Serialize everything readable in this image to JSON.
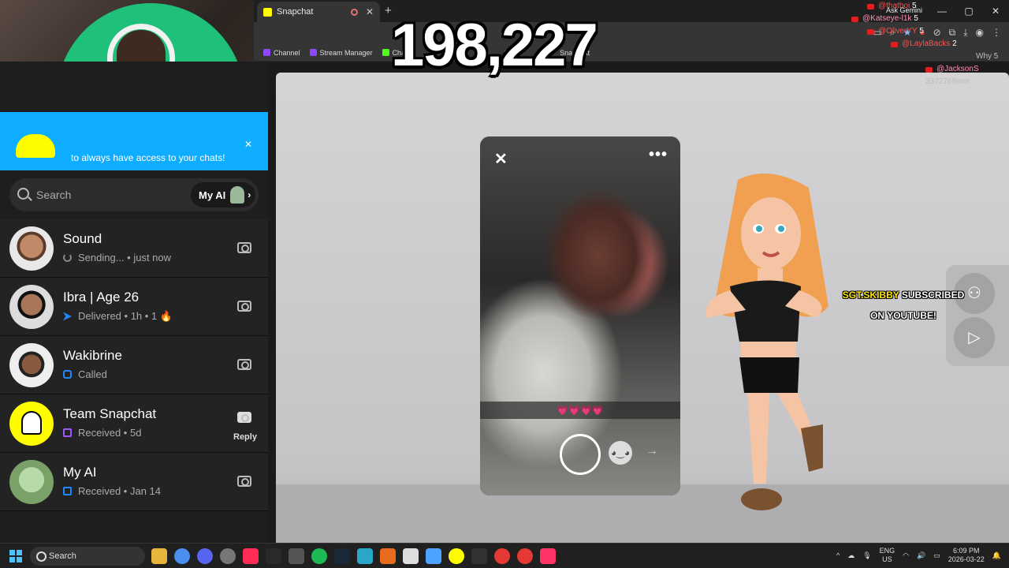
{
  "browser": {
    "tab_title": "Snapchat",
    "new_tab": "+",
    "bookmarks": [
      "Channel",
      "Stream Manager",
      "Chan",
      "(1)",
      "Snapchat"
    ],
    "ask_gemini": "Ask Gemini"
  },
  "stream_overlay": {
    "counter": "198,227",
    "sub_alert_user": "SGT.SKIBBY",
    "sub_alert_text": "SUBSCRIBED ON YOUTUBE!",
    "feed": [
      {
        "user": "@thatboi",
        "count": "5"
      },
      {
        "user": "@Katseye-l1k",
        "count": "5"
      },
      {
        "user": "@OliverYY",
        "count": "5"
      },
      {
        "user": "@LaylaBacks",
        "count": "2"
      },
      {
        "user": "Why 5",
        "count": ""
      },
      {
        "user": "@JacksonS",
        "count": ""
      },
      {
        "user": "3372769mm",
        "count": ""
      }
    ]
  },
  "sidebar": {
    "banner_line": "to always have access to your chats!",
    "search_placeholder": "Search",
    "my_ai_label": "My AI",
    "chats": [
      {
        "name": "Sound",
        "status": "Sending... • just now",
        "status_icon": "spinner-icon",
        "action": ""
      },
      {
        "name": "Ibra | Age 26",
        "status": "Delivered • 1h • 1 🔥",
        "status_icon": "delivered-arrow-icon",
        "action": ""
      },
      {
        "name": "Wakibrine",
        "status": "Called",
        "status_icon": "phone-call-icon",
        "action": ""
      },
      {
        "name": "Team Snapchat",
        "status": "Received • 5d",
        "status_icon": "received-snap-icon",
        "action": "Reply"
      },
      {
        "name": "My AI",
        "status": "Received • Jan 14",
        "status_icon": "received-chat-icon",
        "action": ""
      }
    ]
  },
  "snap_viewer": {
    "caption": "💗💗💗💗",
    "close_symbol": "✕",
    "more_symbol": "•••"
  },
  "taskbar": {
    "search_label": "Search",
    "lang_line1": "ENG",
    "lang_line2": "US",
    "time": "6:09 PM",
    "date": "2026-03-22"
  },
  "colors": {
    "snap_yellow": "#fffc00",
    "banner_blue": "#0fadff",
    "sidebar_bg": "#1e1e1e"
  }
}
